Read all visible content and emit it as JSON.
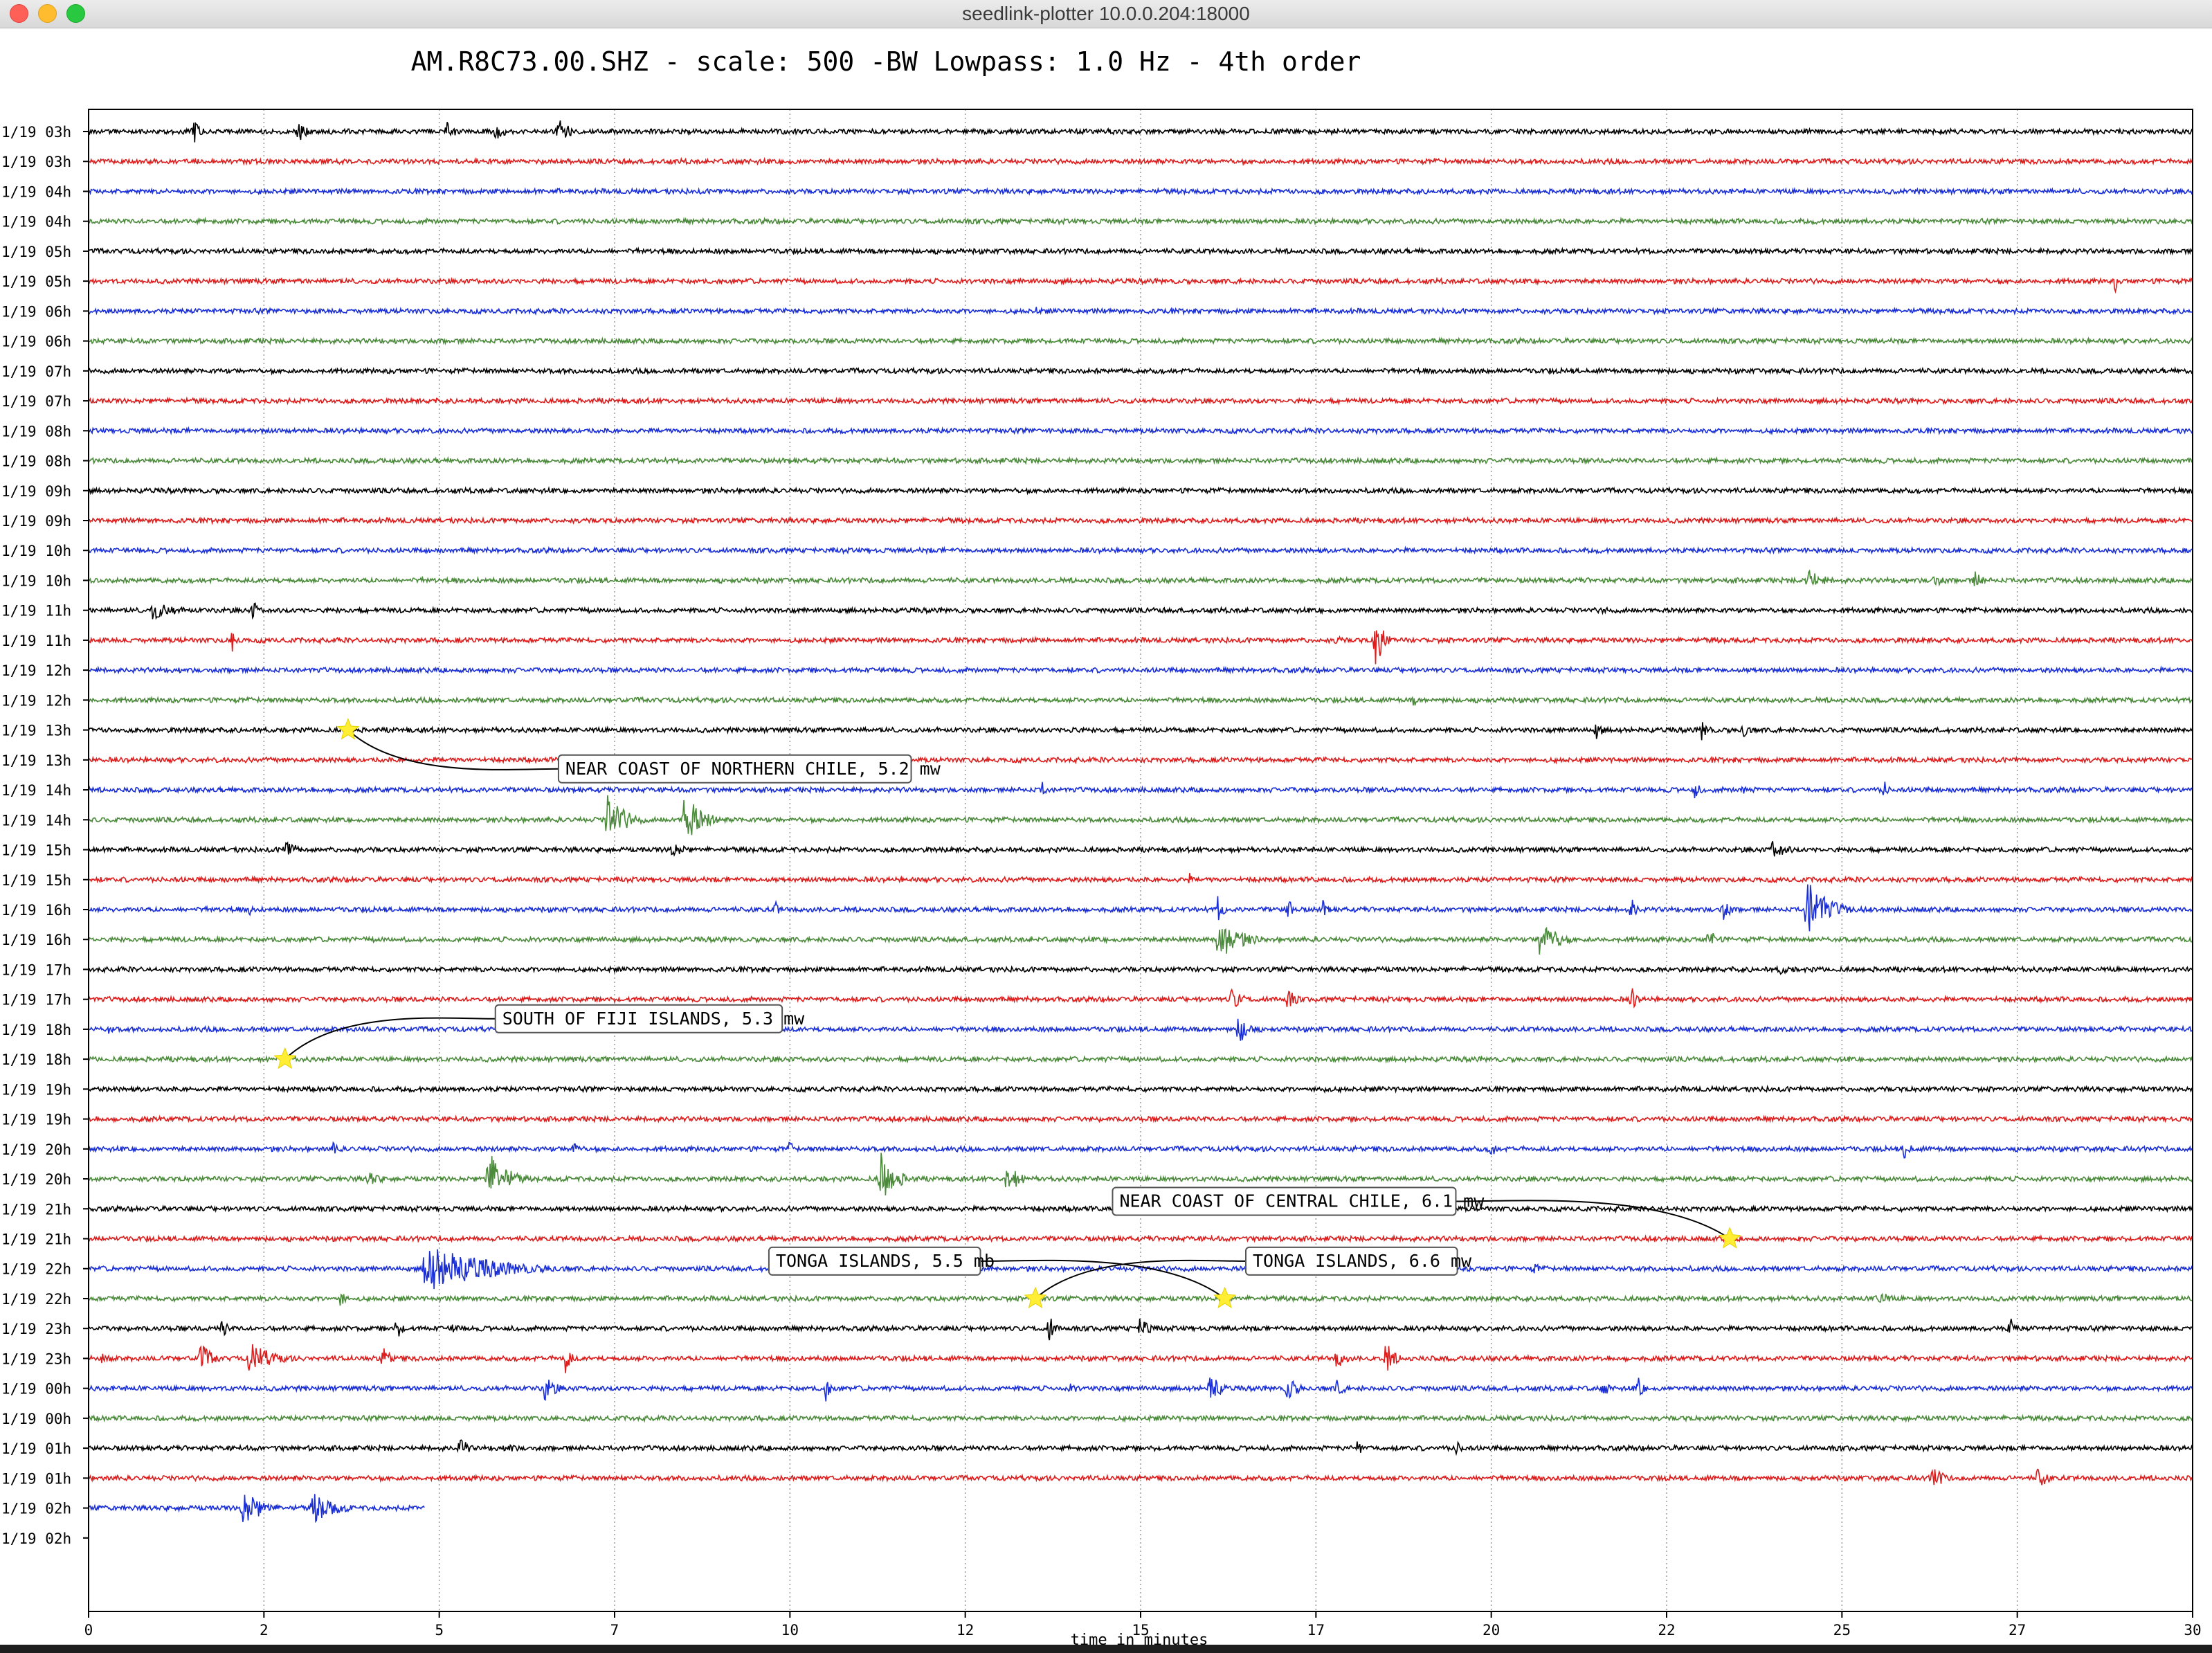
{
  "window": {
    "title": "seedlink-plotter 10.0.0.204:18000"
  },
  "chart_data": {
    "type": "line",
    "title": "AM.R8C73.00.SHZ - scale: 500 -BW Lowpass: 1.0 Hz - 4th order",
    "xlabel": "time in minutes",
    "ylabel": "",
    "xlim": [
      0,
      30
    ],
    "x_ticks": [
      "0",
      "2",
      "5",
      "7",
      "10",
      "12",
      "15",
      "17",
      "20",
      "22",
      "25",
      "27",
      "30"
    ],
    "x_tick_values": [
      0,
      2.5,
      5,
      7.5,
      10,
      12.5,
      15,
      17.5,
      20,
      22.5,
      25,
      27.5,
      30
    ],
    "grid": true,
    "colors": [
      "#000000",
      "#dd1c1c",
      "#1a2ed6",
      "#4a8a3a"
    ],
    "row_labels": [
      "1/19 03h",
      "1/19 03h",
      "1/19 04h",
      "1/19 04h",
      "1/19 05h",
      "1/19 05h",
      "1/19 06h",
      "1/19 06h",
      "1/19 07h",
      "1/19 07h",
      "1/19 08h",
      "1/19 08h",
      "1/19 09h",
      "1/19 09h",
      "1/19 10h",
      "1/19 10h",
      "1/19 11h",
      "1/19 11h",
      "1/19 12h",
      "1/19 12h",
      "1/19 13h",
      "1/19 13h",
      "1/19 14h",
      "1/19 14h",
      "1/19 15h",
      "1/19 15h",
      "1/19 16h",
      "1/19 16h",
      "1/19 17h",
      "1/19 17h",
      "1/19 18h",
      "1/19 18h",
      "1/19 19h",
      "1/19 19h",
      "1/19 20h",
      "1/19 20h",
      "1/19 21h",
      "1/19 21h",
      "1/19 22h",
      "1/19 22h",
      "1/19 23h",
      "1/19 23h",
      "1/19 00h",
      "1/19 00h",
      "1/19 01h",
      "1/19 01h",
      "1/19 02h",
      "1/19 02h"
    ],
    "trace_end_minutes": 4.8,
    "events": [
      {
        "row": 0,
        "time": 1.5,
        "amp": 0.7,
        "width": 0.25
      },
      {
        "row": 0,
        "time": 3.0,
        "amp": 0.6,
        "width": 0.25
      },
      {
        "row": 0,
        "time": 5.1,
        "amp": 0.6,
        "width": 0.3
      },
      {
        "row": 0,
        "time": 5.8,
        "amp": 0.5,
        "width": 0.35
      },
      {
        "row": 0,
        "time": 6.7,
        "amp": 0.75,
        "width": 0.4
      },
      {
        "row": 5,
        "time": 28.9,
        "amp": 0.6,
        "width": 0.05
      },
      {
        "row": 6,
        "time": 13.5,
        "amp": 0.35,
        "width": 0.1
      },
      {
        "row": 15,
        "time": 24.5,
        "amp": 0.6,
        "width": 0.6
      },
      {
        "row": 15,
        "time": 26.3,
        "amp": 0.35,
        "width": 0.5
      },
      {
        "row": 15,
        "time": 26.9,
        "amp": 0.5,
        "width": 0.3
      },
      {
        "row": 16,
        "time": 0.9,
        "amp": 0.5,
        "width": 0.9
      },
      {
        "row": 16,
        "time": 2.35,
        "amp": 0.55,
        "width": 0.2
      },
      {
        "row": 16,
        "time": 21.6,
        "amp": 0.3,
        "width": 0.3
      },
      {
        "row": 17,
        "time": 2.05,
        "amp": 0.6,
        "width": 0.2
      },
      {
        "row": 17,
        "time": 17.8,
        "amp": 0.35,
        "width": 0.2
      },
      {
        "row": 17,
        "time": 18.35,
        "amp": 1.6,
        "width": 0.25
      },
      {
        "row": 19,
        "time": 18.9,
        "amp": 0.4,
        "width": 0.1
      },
      {
        "row": 20,
        "time": 14.0,
        "amp": 0.3,
        "width": 0.3
      },
      {
        "row": 20,
        "time": 21.5,
        "amp": 0.5,
        "width": 0.25
      },
      {
        "row": 20,
        "time": 23.0,
        "amp": 0.6,
        "width": 0.25
      },
      {
        "row": 20,
        "time": 23.6,
        "amp": 0.55,
        "width": 0.2
      },
      {
        "row": 22,
        "time": 13.6,
        "amp": 0.5,
        "width": 0.15
      },
      {
        "row": 22,
        "time": 22.9,
        "amp": 0.5,
        "width": 0.2
      },
      {
        "row": 22,
        "time": 23.6,
        "amp": 0.35,
        "width": 0.2
      },
      {
        "row": 22,
        "time": 25.6,
        "amp": 0.55,
        "width": 0.15
      },
      {
        "row": 23,
        "time": 7.4,
        "amp": 1.4,
        "width": 0.6
      },
      {
        "row": 23,
        "time": 8.5,
        "amp": 1.4,
        "width": 0.6
      },
      {
        "row": 24,
        "time": 2.8,
        "amp": 0.5,
        "width": 0.5
      },
      {
        "row": 24,
        "time": 8.3,
        "amp": 0.5,
        "width": 0.5
      },
      {
        "row": 24,
        "time": 24.0,
        "amp": 0.5,
        "width": 0.6
      },
      {
        "row": 25,
        "time": 15.7,
        "amp": 0.35,
        "width": 0.1
      },
      {
        "row": 26,
        "time": 2.3,
        "amp": 0.3,
        "width": 0.2
      },
      {
        "row": 26,
        "time": 9.8,
        "amp": 0.45,
        "width": 0.15
      },
      {
        "row": 26,
        "time": 16.1,
        "amp": 0.7,
        "width": 0.2
      },
      {
        "row": 26,
        "time": 17.1,
        "amp": 0.7,
        "width": 0.2
      },
      {
        "row": 26,
        "time": 17.6,
        "amp": 0.5,
        "width": 0.2
      },
      {
        "row": 26,
        "time": 22.0,
        "amp": 0.6,
        "width": 0.2
      },
      {
        "row": 26,
        "time": 23.3,
        "amp": 0.6,
        "width": 0.3
      },
      {
        "row": 26,
        "time": 24.5,
        "amp": 1.6,
        "width": 0.7
      },
      {
        "row": 27,
        "time": 16.1,
        "amp": 1.1,
        "width": 0.8
      },
      {
        "row": 27,
        "time": 20.7,
        "amp": 1.3,
        "width": 0.5
      },
      {
        "row": 27,
        "time": 23.1,
        "amp": 0.6,
        "width": 0.3
      },
      {
        "row": 28,
        "time": 24.1,
        "amp": 0.3,
        "width": 0.5
      },
      {
        "row": 29,
        "time": 16.3,
        "amp": 0.6,
        "width": 0.4
      },
      {
        "row": 29,
        "time": 17.1,
        "amp": 0.6,
        "width": 0.3
      },
      {
        "row": 29,
        "time": 22.0,
        "amp": 0.7,
        "width": 0.2
      },
      {
        "row": 30,
        "time": 0.3,
        "amp": 0.35,
        "width": 0.1
      },
      {
        "row": 30,
        "time": 16.4,
        "amp": 0.8,
        "width": 0.4
      },
      {
        "row": 32,
        "time": 17.6,
        "amp": 0.55,
        "width": 0.15
      },
      {
        "row": 34,
        "time": 3.5,
        "amp": 0.45,
        "width": 0.2
      },
      {
        "row": 34,
        "time": 6.9,
        "amp": 0.6,
        "width": 0.2
      },
      {
        "row": 34,
        "time": 10.0,
        "amp": 0.45,
        "width": 0.15
      },
      {
        "row": 34,
        "time": 20.0,
        "amp": 0.6,
        "width": 0.15
      },
      {
        "row": 34,
        "time": 25.9,
        "amp": 0.7,
        "width": 0.2
      },
      {
        "row": 35,
        "time": 4.0,
        "amp": 0.5,
        "width": 0.4
      },
      {
        "row": 35,
        "time": 5.7,
        "amp": 1.6,
        "width": 0.6
      },
      {
        "row": 35,
        "time": 11.3,
        "amp": 1.4,
        "width": 0.5
      },
      {
        "row": 35,
        "time": 13.1,
        "amp": 0.9,
        "width": 0.4
      },
      {
        "row": 38,
        "time": 4.8,
        "amp": 1.3,
        "width": 2.2
      },
      {
        "row": 38,
        "time": 20.6,
        "amp": 0.3,
        "width": 0.4
      },
      {
        "row": 39,
        "time": 3.6,
        "amp": 0.5,
        "width": 0.2
      },
      {
        "row": 39,
        "time": 25.5,
        "amp": 0.45,
        "width": 0.5
      },
      {
        "row": 40,
        "time": 1.9,
        "amp": 0.6,
        "width": 0.2
      },
      {
        "row": 40,
        "time": 4.4,
        "amp": 0.6,
        "width": 0.2
      },
      {
        "row": 40,
        "time": 5.2,
        "amp": 0.35,
        "width": 0.2
      },
      {
        "row": 40,
        "time": 13.7,
        "amp": 0.8,
        "width": 0.2
      },
      {
        "row": 40,
        "time": 15.0,
        "amp": 0.7,
        "width": 0.3
      },
      {
        "row": 40,
        "time": 27.4,
        "amp": 0.6,
        "width": 0.2
      },
      {
        "row": 41,
        "time": 0.2,
        "amp": 0.4,
        "width": 0.3
      },
      {
        "row": 41,
        "time": 1.6,
        "amp": 0.8,
        "width": 0.4
      },
      {
        "row": 41,
        "time": 2.3,
        "amp": 0.9,
        "width": 0.8
      },
      {
        "row": 41,
        "time": 4.2,
        "amp": 0.6,
        "width": 0.3
      },
      {
        "row": 41,
        "time": 6.8,
        "amp": 0.8,
        "width": 0.2
      },
      {
        "row": 41,
        "time": 17.8,
        "amp": 0.6,
        "width": 0.3
      },
      {
        "row": 41,
        "time": 18.5,
        "amp": 0.9,
        "width": 0.3
      },
      {
        "row": 42,
        "time": 6.5,
        "amp": 0.7,
        "width": 0.4
      },
      {
        "row": 42,
        "time": 10.5,
        "amp": 0.8,
        "width": 0.2
      },
      {
        "row": 42,
        "time": 14.0,
        "amp": 0.3,
        "width": 0.4
      },
      {
        "row": 42,
        "time": 16.0,
        "amp": 1.0,
        "width": 0.3
      },
      {
        "row": 42,
        "time": 17.1,
        "amp": 0.8,
        "width": 0.3
      },
      {
        "row": 42,
        "time": 17.8,
        "amp": 0.5,
        "width": 0.3
      },
      {
        "row": 42,
        "time": 21.6,
        "amp": 0.5,
        "width": 0.2
      },
      {
        "row": 42,
        "time": 22.1,
        "amp": 0.6,
        "width": 0.2
      },
      {
        "row": 44,
        "time": 5.3,
        "amp": 0.6,
        "width": 0.3
      },
      {
        "row": 44,
        "time": 6.0,
        "amp": 0.3,
        "width": 0.3
      },
      {
        "row": 44,
        "time": 18.1,
        "amp": 0.5,
        "width": 0.15
      },
      {
        "row": 44,
        "time": 19.5,
        "amp": 0.4,
        "width": 0.3
      },
      {
        "row": 45,
        "time": 26.3,
        "amp": 0.8,
        "width": 0.3
      },
      {
        "row": 45,
        "time": 27.8,
        "amp": 0.7,
        "width": 0.3
      },
      {
        "row": 46,
        "time": 2.2,
        "amp": 1.0,
        "width": 0.7
      },
      {
        "row": 46,
        "time": 3.2,
        "amp": 0.8,
        "width": 0.8
      }
    ],
    "annotations": [
      {
        "label": "NEAR COAST OF NORTHERN CHILE, 5.2 mw",
        "star_time": 3.7,
        "star_row": 20,
        "box_time": 6.7,
        "box_row": 21.3
      },
      {
        "label": "SOUTH OF FIJI ISLANDS, 5.3 mw",
        "star_time": 2.8,
        "star_row": 31,
        "box_time": 5.8,
        "box_row": 29.65
      },
      {
        "label": "NEAR COAST OF CENTRAL CHILE, 6.1 mw",
        "star_time": 23.4,
        "star_row": 37,
        "box_time": 14.6,
        "box_row": 35.75
      },
      {
        "label": "TONGA ISLANDS, 5.5 mb",
        "star_time": 16.2,
        "star_row": 39,
        "box_time": 9.7,
        "box_row": 37.75
      },
      {
        "label": "TONGA ISLANDS, 6.6 mw",
        "star_time": 13.5,
        "star_row": 39,
        "box_time": 16.5,
        "box_row": 37.75
      }
    ]
  }
}
